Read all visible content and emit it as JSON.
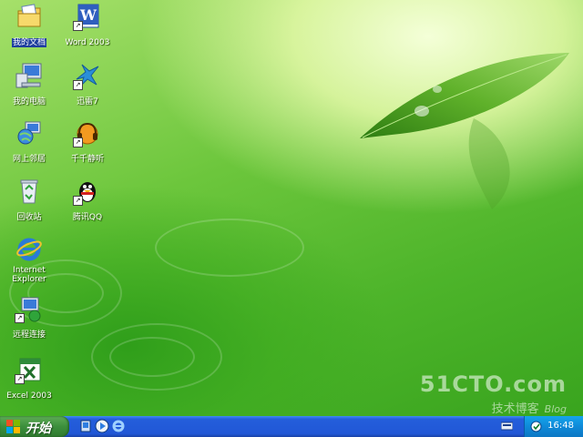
{
  "desktop": {
    "watermark": {
      "main": "51CTO.com",
      "sub": "技术博客",
      "blog": "Blog"
    },
    "icons": [
      {
        "id": "my-documents",
        "label": "我的文档",
        "selected": true
      },
      {
        "id": "word-2003",
        "label": "Word 2003"
      },
      {
        "id": "my-computer",
        "label": "我的电脑"
      },
      {
        "id": "xunlei",
        "label": "迅雷7"
      },
      {
        "id": "network-places",
        "label": "网上邻居"
      },
      {
        "id": "ttplayer",
        "label": "千千静听"
      },
      {
        "id": "recycle-bin",
        "label": "回收站"
      },
      {
        "id": "tencent-qq",
        "label": "腾讯QQ"
      },
      {
        "id": "internet-explorer",
        "label": "Internet\nExplorer"
      },
      {
        "id": "remote-desktop",
        "label": "远程连接"
      },
      {
        "id": "excel-2003",
        "label": "Excel 2003"
      }
    ]
  },
  "taskbar": {
    "start_label": "开始",
    "quick_launch": [
      "show-desktop-icon",
      "media-player-icon",
      "internet-explorer-icon"
    ],
    "clock": "16:48",
    "colors": {
      "taskbar": "#245edb",
      "start": "#3c8f3c",
      "tray": "#0f8ad8"
    }
  }
}
